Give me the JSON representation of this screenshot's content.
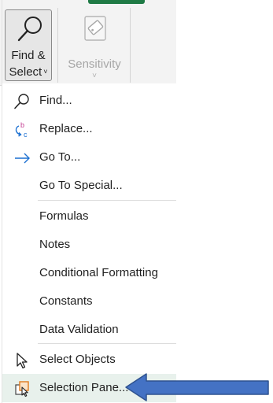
{
  "ribbon": {
    "find_select": {
      "line1": "Find &",
      "line2": "Select",
      "chevron": "˅",
      "icon": "magnifier-icon"
    },
    "sensitivity": {
      "label": "Sensitivity",
      "chevron": "˅",
      "icon": "sensitivity-tag-icon",
      "disabled": true
    }
  },
  "menu": {
    "items": [
      {
        "label": "Find...",
        "icon": "magnifier-icon"
      },
      {
        "label": "Replace...",
        "icon": "replace-icon"
      },
      {
        "label": "Go To...",
        "icon": "right-arrow-icon"
      },
      {
        "label": "Go To Special...",
        "icon": ""
      },
      {
        "label": "Formulas",
        "icon": ""
      },
      {
        "label": "Notes",
        "icon": ""
      },
      {
        "label": "Conditional Formatting",
        "icon": ""
      },
      {
        "label": "Constants",
        "icon": ""
      },
      {
        "label": "Data Validation",
        "icon": ""
      },
      {
        "label": "Select Objects",
        "icon": "select-pointer-icon"
      },
      {
        "label": "Selection Pane...",
        "icon": "selection-pane-icon",
        "highlighted": true
      }
    ]
  },
  "colors": {
    "accent_green": "#1f7a45",
    "replace_blue": "#1a6fd1",
    "replace_pink": "#c2368e",
    "annotation_arrow": "#4472c4",
    "selection_pane_orange": "#e07a1f"
  },
  "annotation": {
    "icon": "left-pointing-block-arrow",
    "points_to": "Selection Pane..."
  }
}
